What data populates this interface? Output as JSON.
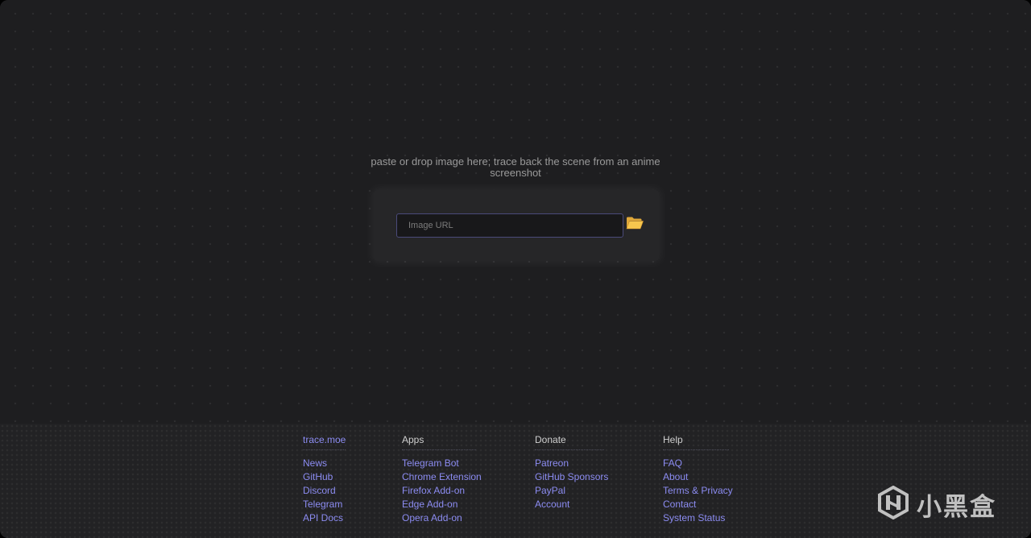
{
  "tagline": "paste or drop image here; trace back the scene from an anime screenshot",
  "search": {
    "placeholder": "Image URL",
    "value": "",
    "browse_icon": "folder-icon"
  },
  "footer": {
    "columns": [
      {
        "title": "trace.moe",
        "title_is_link": true,
        "items": [
          "News",
          "GitHub",
          "Discord",
          "Telegram",
          "API Docs"
        ]
      },
      {
        "title": "Apps",
        "title_is_link": false,
        "items": [
          "Telegram Bot",
          "Chrome Extension",
          "Firefox Add-on",
          "Edge Add-on",
          "Opera Add-on"
        ]
      },
      {
        "title": "Donate",
        "title_is_link": false,
        "items": [
          "Patreon",
          "GitHub Sponsors",
          "PayPal",
          "Account"
        ]
      },
      {
        "title": "Help",
        "title_is_link": false,
        "items": [
          "FAQ",
          "About",
          "Terms & Privacy",
          "Contact",
          "System Status"
        ]
      }
    ]
  },
  "watermark": {
    "text": "小黑盒",
    "icon": "xiaoheihe-logo-icon"
  },
  "colors": {
    "background": "#1e1e20",
    "card": "#262628",
    "link": "#8c8cf2",
    "text_muted": "#9a9a9a",
    "folder": "#f5c24a"
  }
}
